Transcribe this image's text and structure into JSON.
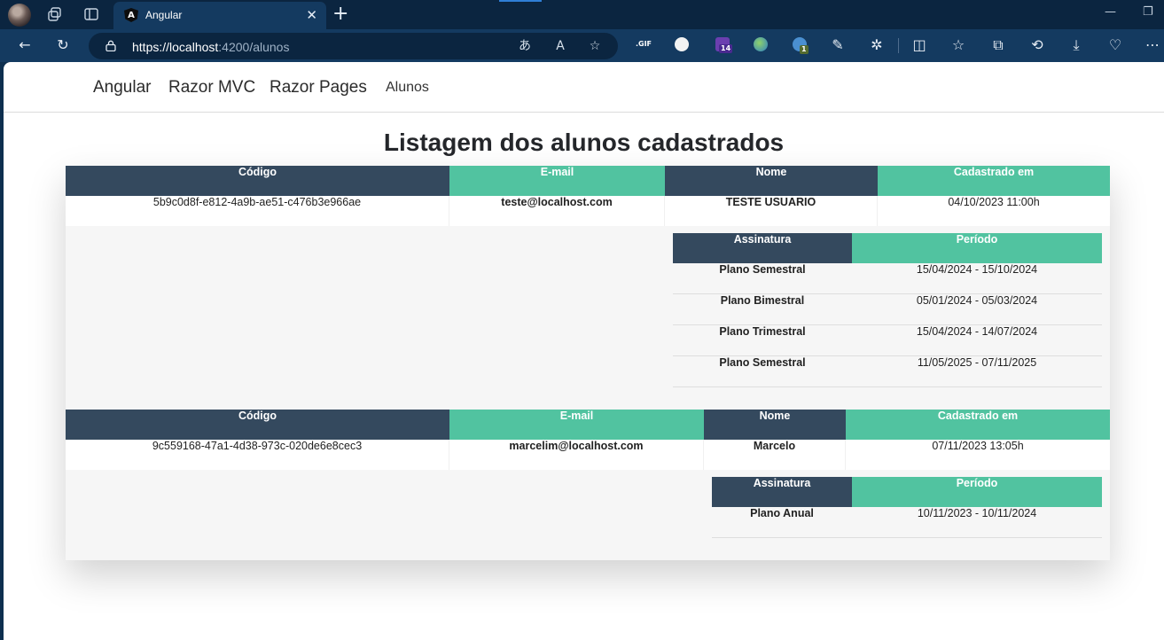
{
  "browser": {
    "tab": {
      "title": "Angular",
      "favicon_letter": "A",
      "close": "✕"
    },
    "new_tab": "+",
    "address": {
      "scheme_and_host": "https://localhost",
      "port_and_path": ":4200/alunos"
    },
    "extension_badges": {
      "ext3": "14",
      "ext5": "1"
    },
    "ext_gif_label": ".GIF"
  },
  "nav": {
    "links": [
      "Angular",
      "Razor MVC",
      "Razor Pages"
    ],
    "alunos_link": "Alunos"
  },
  "page": {
    "title": "Listagem dos alunos cadastrados"
  },
  "headers": {
    "codigo": "Código",
    "email": "E-mail",
    "nome": "Nome",
    "cadastrado": "Cadastrado em",
    "assinatura": "Assinatura",
    "periodo": "Período"
  },
  "students": [
    {
      "codigo": "5b9c0d8f-e812-4a9b-ae51-c476b3e966ae",
      "email": "teste@localhost.com",
      "nome": "TESTE USUARIO",
      "cadastrado": "04/10/2023 11:00h",
      "assinaturas": [
        {
          "plano": "Plano Semestral",
          "periodo": "15/04/2024 - 15/10/2024"
        },
        {
          "plano": "Plano Bimestral",
          "periodo": "05/01/2024 - 05/03/2024"
        },
        {
          "plano": "Plano Trimestral",
          "periodo": "15/04/2024 - 14/07/2024"
        },
        {
          "plano": "Plano Semestral",
          "periodo": "11/05/2025 - 07/11/2025"
        }
      ]
    },
    {
      "codigo": "9c559168-47a1-4d38-973c-020de6e8cec3",
      "email": "marcelim@localhost.com",
      "nome": "Marcelo",
      "cadastrado": "07/11/2023 13:05h",
      "assinaturas": [
        {
          "plano": "Plano Anual",
          "periodo": "10/11/2023 - 10/11/2024"
        }
      ]
    }
  ],
  "colors": {
    "header_dark": "#34495e",
    "header_green": "#51c3a0",
    "browser_frame": "#143a60"
  }
}
